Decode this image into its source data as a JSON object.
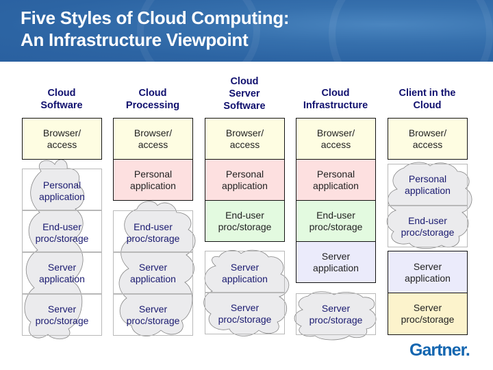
{
  "title": {
    "line1": "Five Styles of Cloud Computing:",
    "line2": "An Infrastructure Viewpoint"
  },
  "columns": [
    {
      "heading": [
        "Cloud",
        "Software"
      ]
    },
    {
      "heading": [
        "Cloud",
        "Processing"
      ]
    },
    {
      "heading": [
        "Cloud",
        "Server",
        "Software"
      ]
    },
    {
      "heading": [
        "Cloud",
        "Infrastructure"
      ]
    },
    {
      "heading": [
        "Client in the",
        "Cloud"
      ]
    }
  ],
  "layers": {
    "browser": [
      "Browser/",
      "access"
    ],
    "personal": [
      "Personal",
      "application"
    ],
    "enduser": [
      "End-user",
      "proc/storage"
    ],
    "serverapp": [
      "Server",
      "application"
    ],
    "serverstorage": [
      "Server",
      "proc/storage"
    ]
  },
  "legend_colors": {
    "browser": "#fefde2",
    "personal": "#fde0e0",
    "enduser": "#e3fae0",
    "serverapp": "#ebebfb",
    "serverstorage": "#fcf3cc",
    "cloud": "#e8e8e8",
    "header": "#2f6aa8",
    "heading_text": "#10106e"
  },
  "logo": "Gartner."
}
